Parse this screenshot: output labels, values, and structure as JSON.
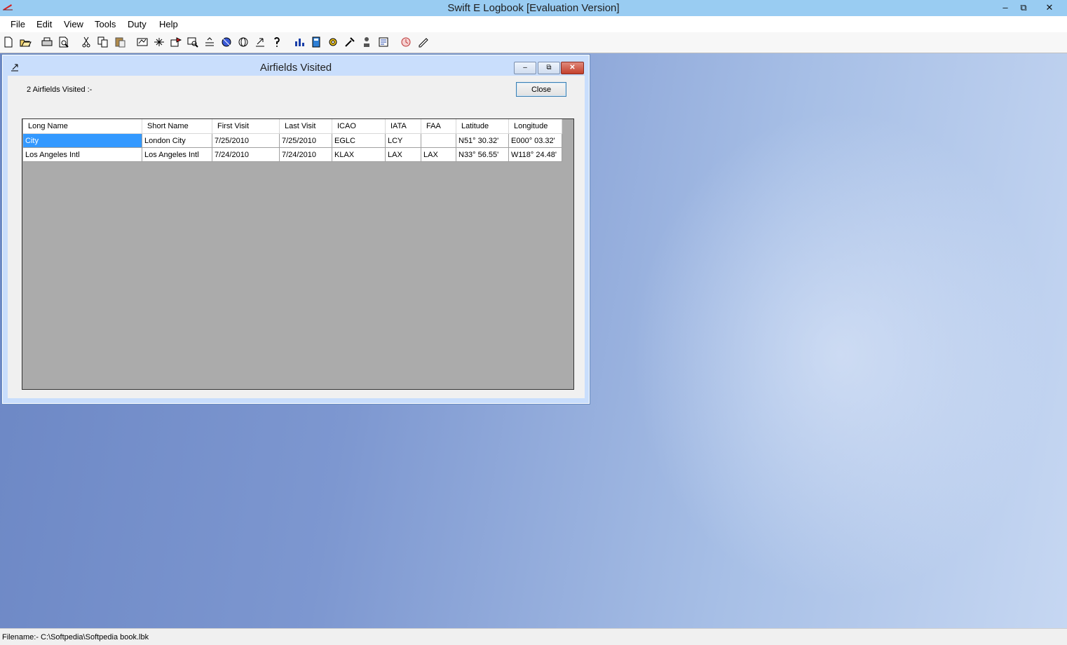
{
  "app": {
    "title": "Swift E Logbook [Evaluation Version]",
    "minimize_glyph": "–",
    "restore_glyph": "⧉",
    "close_glyph": "✕"
  },
  "menu": {
    "items": [
      "File",
      "Edit",
      "View",
      "Tools",
      "Duty",
      "Help"
    ]
  },
  "toolbar": {
    "icons": [
      "new-icon",
      "open-icon",
      "print-icon",
      "print-preview-icon",
      "cut-icon",
      "copy-icon",
      "paste-icon",
      "flights-icon",
      "aircraft-icon",
      "airfields-icon",
      "search-icon",
      "totals-icon",
      "map-icon",
      "globe-icon",
      "import-icon",
      "help-icon",
      "chart-icon",
      "calculator-icon",
      "settings-icon",
      "tools-icon",
      "person-icon",
      "report-icon",
      "duty-icon",
      "notes-icon"
    ]
  },
  "dialog": {
    "title": "Airfields Visited",
    "count_label": "2 Airfields Visited :-",
    "close_label": "Close",
    "minimize_glyph": "–",
    "restore_glyph": "⧉",
    "close_glyph": "✕"
  },
  "grid": {
    "columns": [
      "Long Name",
      "Short Name",
      "First Visit",
      "Last Visit",
      "ICAO",
      "IATA",
      "FAA",
      "Latitude",
      "Longitude"
    ],
    "rows": [
      [
        "City",
        "London City",
        "7/25/2010",
        "7/25/2010",
        "EGLC",
        "LCY",
        "",
        "N51° 30.32'",
        "E000° 03.32'"
      ],
      [
        "Los Angeles Intl",
        "Los Angeles Intl",
        "7/24/2010",
        "7/24/2010",
        "KLAX",
        "LAX",
        "LAX",
        "N33° 56.55'",
        "W118° 24.48'"
      ]
    ],
    "selected_row": 0,
    "selected_col": 0
  },
  "status": {
    "filename": "Filename:- C:\\Softpedia\\Softpedia book.lbk"
  },
  "colors": {
    "titlebar": "#99ccf2",
    "selection": "#3399ff",
    "dialog_frame": "#c9defc"
  }
}
